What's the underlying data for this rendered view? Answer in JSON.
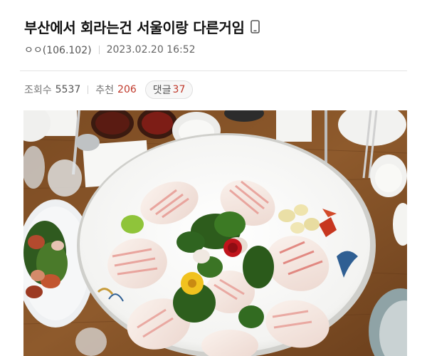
{
  "post": {
    "title": "부산에서 회라는건 서울이랑 다른거임",
    "author": "ㅇㅇ(106.102)",
    "date": "2023.02.20 16:52"
  },
  "stats": {
    "views_label": "조회수",
    "views": "5537",
    "recommend_label": "추천",
    "recommend": "206",
    "comments_label": "댓글",
    "comments": "37"
  },
  "colors": {
    "accent_red": "#c0392b",
    "mobile_icon": "#555555"
  },
  "icons": {
    "device": "mobile-phone-icon"
  },
  "image": {
    "subject": "sliced raw fish platter on wooden table"
  }
}
